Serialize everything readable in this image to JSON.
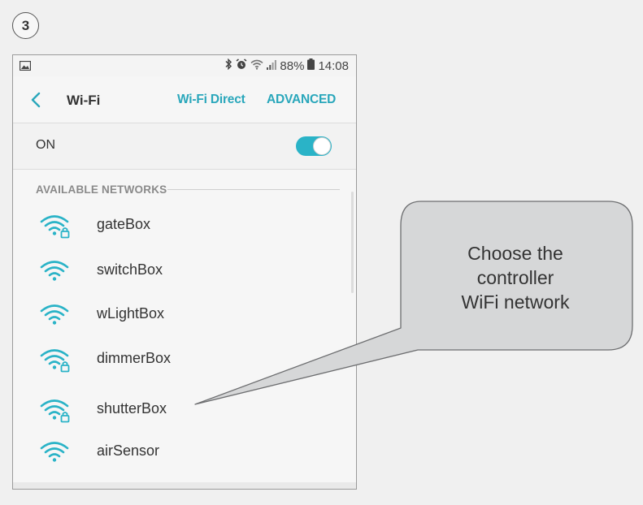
{
  "step_number": "3",
  "status_bar": {
    "battery": "88%",
    "time": "14:08"
  },
  "toolbar": {
    "title": "Wi-Fi",
    "wifi_direct_label": "Wi-Fi Direct",
    "advanced_label": "ADVANCED"
  },
  "wifi_toggle": {
    "label": "ON",
    "state": "on",
    "accent_color": "#2ab3c7"
  },
  "section_header": "AVAILABLE NETWORKS",
  "networks": [
    {
      "name": "gateBox",
      "locked": true
    },
    {
      "name": "switchBox",
      "locked": false
    },
    {
      "name": "wLightBox",
      "locked": false
    },
    {
      "name": "dimmerBox",
      "locked": true
    },
    {
      "name": "shutterBox",
      "locked": true
    },
    {
      "name": "airSensor",
      "locked": false
    }
  ],
  "callout": {
    "line1": "Choose the",
    "line2": "controller",
    "line3": "WiFi network"
  },
  "icons": [
    "image-icon",
    "bluetooth-icon",
    "alarm-icon",
    "wifi-icon",
    "signal-icon",
    "battery-icon",
    "back-arrow-icon",
    "wifi-lock-icon"
  ]
}
